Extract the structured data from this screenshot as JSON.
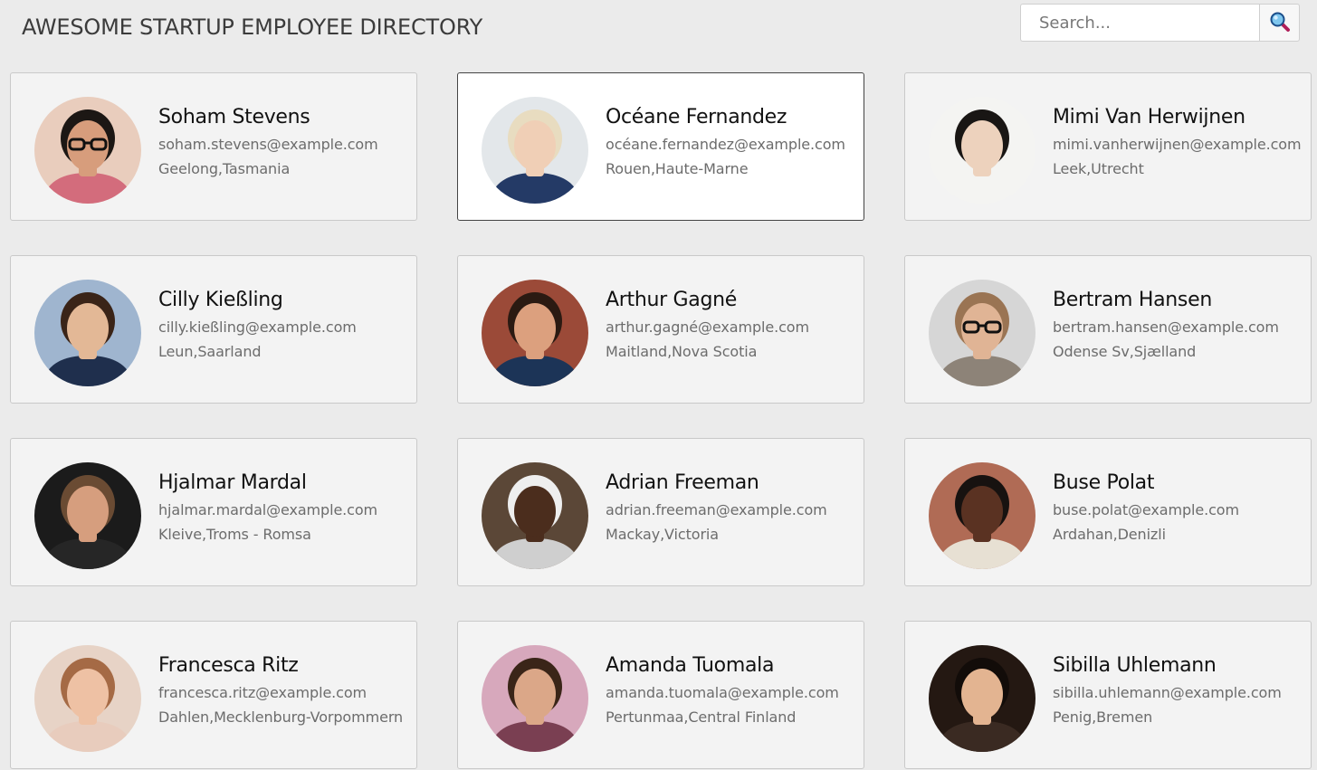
{
  "header": {
    "title": "AWESOME STARTUP EMPLOYEE DIRECTORY",
    "search": {
      "placeholder": "Search...",
      "value": ""
    }
  },
  "colors": {
    "background": "#ebebeb",
    "card_background": "#f3f3f3",
    "card_selected_background": "#ffffff",
    "card_border": "#c9c9c9",
    "card_selected_border": "#444444",
    "name_text": "#111111",
    "detail_text": "#6c6c6c"
  },
  "employees": [
    {
      "name": "Soham Stevens",
      "email": "soham.stevens@example.com",
      "location": "Geelong,Tasmania",
      "selected": false,
      "avatar": {
        "bg": "#e9cdbd",
        "skin": "#d79d7c",
        "hair": "#1c1714",
        "shirt": "#d36c7c",
        "glasses": true
      }
    },
    {
      "name": "Océane Fernandez",
      "email": "océane.fernandez@example.com",
      "location": "Rouen,Haute-Marne",
      "selected": true,
      "avatar": {
        "bg": "#e3e7ea",
        "skin": "#f0cfb6",
        "hair": "#e8dcc0",
        "shirt": "#243a66",
        "glasses": false
      }
    },
    {
      "name": "Mimi Van Herwijnen",
      "email": "mimi.vanherwijnen@example.com",
      "location": "Leek,Utrecht",
      "selected": false,
      "avatar": {
        "bg": "#f4f4f2",
        "skin": "#edd2bd",
        "hair": "#191614",
        "shirt": "#f4f4f2",
        "glasses": false
      }
    },
    {
      "name": "Cilly Kießling",
      "email": "cilly.kießling@example.com",
      "location": "Leun,Saarland",
      "selected": false,
      "avatar": {
        "bg": "#9fb5cf",
        "skin": "#e3b896",
        "hair": "#3a2418",
        "shirt": "#1f2f4d",
        "glasses": false
      }
    },
    {
      "name": "Arthur Gagné",
      "email": "arthur.gagné@example.com",
      "location": "Maitland,Nova Scotia",
      "selected": false,
      "avatar": {
        "bg": "#9b4a38",
        "skin": "#dca07e",
        "hair": "#2b1a12",
        "shirt": "#1c3457",
        "glasses": false
      }
    },
    {
      "name": "Bertram Hansen",
      "email": "bertram.hansen@example.com",
      "location": "Odense Sv,Sjælland",
      "selected": false,
      "avatar": {
        "bg": "#d6d6d6",
        "skin": "#e0b495",
        "hair": "#9a7453",
        "shirt": "#8d8378",
        "glasses": true
      }
    },
    {
      "name": "Hjalmar Mardal",
      "email": "hjalmar.mardal@example.com",
      "location": "Kleive,Troms - Romsa",
      "selected": false,
      "avatar": {
        "bg": "#1b1b1b",
        "skin": "#d69e7e",
        "hair": "#6a4b33",
        "shirt": "#262626",
        "glasses": false
      }
    },
    {
      "name": "Adrian Freeman",
      "email": "adrian.freeman@example.com",
      "location": "Mackay,Victoria",
      "selected": false,
      "avatar": {
        "bg": "#5b4737",
        "skin": "#4b2d1d",
        "hair": "#eeeeee",
        "shirt": "#cfcfcf",
        "glasses": false
      }
    },
    {
      "name": "Buse Polat",
      "email": "buse.polat@example.com",
      "location": "Ardahan,Denizli",
      "selected": false,
      "avatar": {
        "bg": "#b06b55",
        "skin": "#5a3222",
        "hair": "#171210",
        "shirt": "#e7e0d3",
        "glasses": false
      }
    },
    {
      "name": "Francesca Ritz",
      "email": "francesca.ritz@example.com",
      "location": "Dahlen,Mecklenburg-Vorpommern",
      "selected": false,
      "avatar": {
        "bg": "#e7d3c6",
        "skin": "#eec1a4",
        "hair": "#a56a45",
        "shirt": "#e8ccbd",
        "glasses": false
      }
    },
    {
      "name": "Amanda Tuomala",
      "email": "amanda.tuomala@example.com",
      "location": "Pertunmaa,Central Finland",
      "selected": false,
      "avatar": {
        "bg": "#d7a8bc",
        "skin": "#dba788",
        "hair": "#3a2518",
        "shirt": "#7a3f52",
        "glasses": false
      }
    },
    {
      "name": "Sibilla Uhlemann",
      "email": "sibilla.uhlemann@example.com",
      "location": "Penig,Bremen",
      "selected": false,
      "avatar": {
        "bg": "#241812",
        "skin": "#e3b491",
        "hair": "#120c09",
        "shirt": "#3a2a22",
        "glasses": false
      }
    }
  ]
}
